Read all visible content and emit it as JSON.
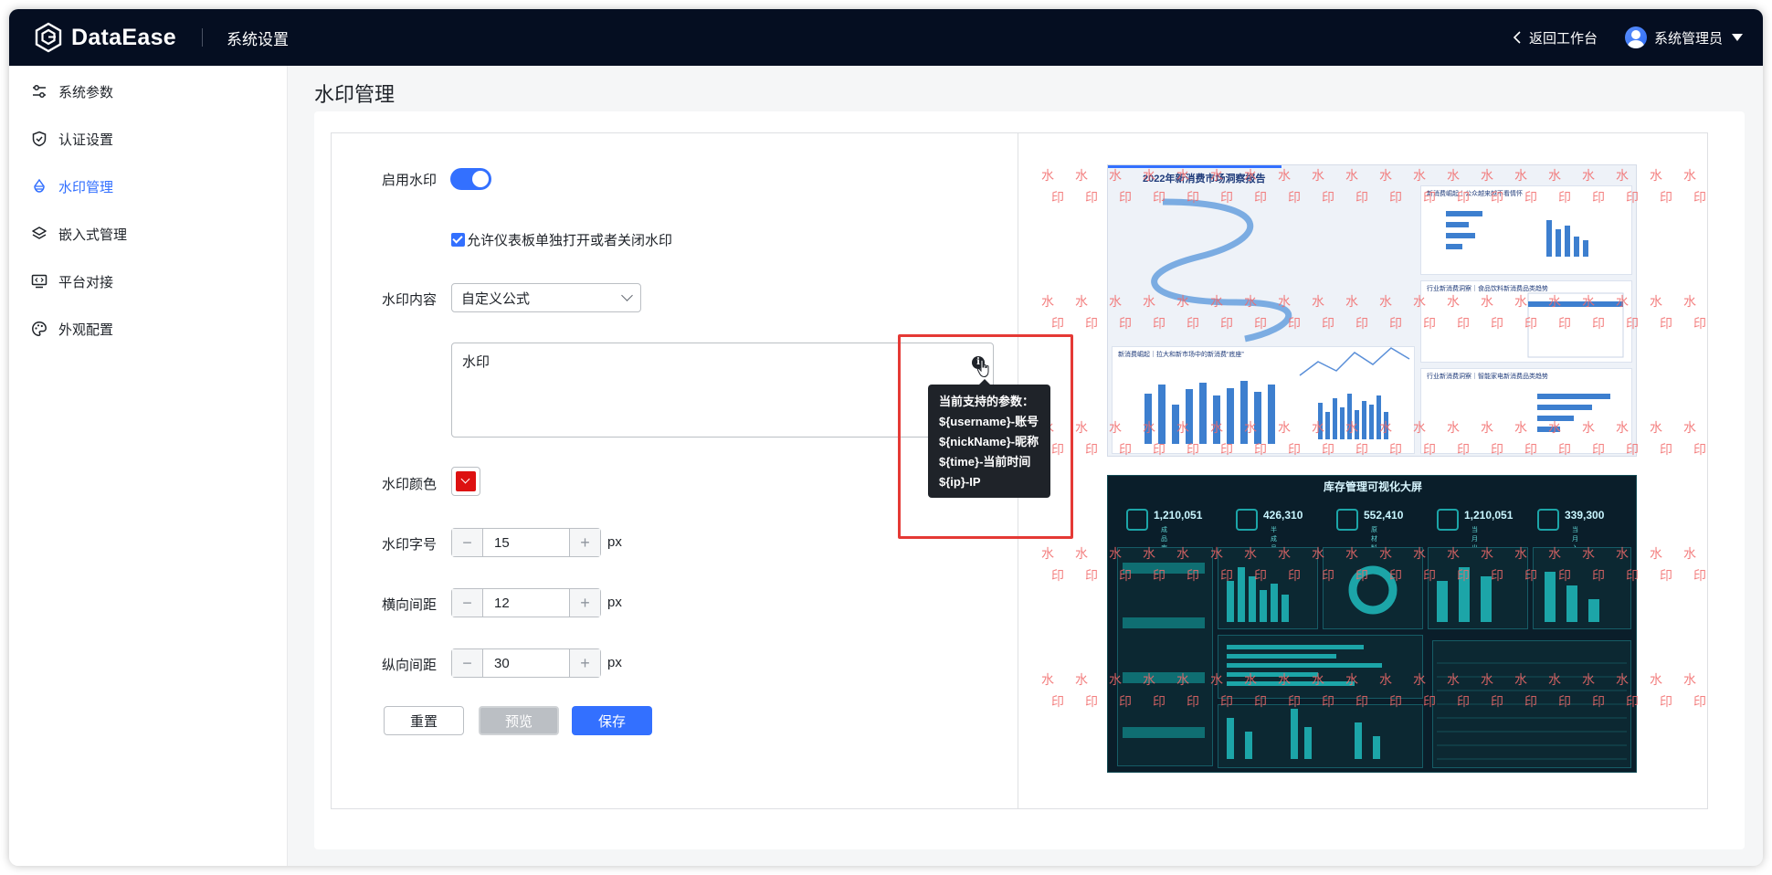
{
  "header": {
    "logo_text": "DataEase",
    "section_title": "系统设置",
    "back_label": "返回工作台",
    "user_name": "系统管理员"
  },
  "sidebar": {
    "items": [
      {
        "label": "系统参数",
        "icon": "sliders-icon",
        "active": false
      },
      {
        "label": "认证设置",
        "icon": "shield-check-icon",
        "active": false
      },
      {
        "label": "水印管理",
        "icon": "watermark-icon",
        "active": true
      },
      {
        "label": "嵌入式管理",
        "icon": "layers-icon",
        "active": false
      },
      {
        "label": "平台对接",
        "icon": "monitor-code-icon",
        "active": false
      },
      {
        "label": "外观配置",
        "icon": "palette-icon",
        "active": false
      }
    ]
  },
  "page": {
    "title": "水印管理"
  },
  "form": {
    "enable_label": "启用水印",
    "enable_on": true,
    "allow_toggle_label": "允许仪表板单独打开或者关闭水印",
    "allow_toggle_checked": true,
    "content_label": "水印内容",
    "content_type": "自定义公式",
    "content_text": "水印",
    "color_label": "水印颜色",
    "color_value": "#DD1111",
    "font_size_label": "水印字号",
    "font_size": "15",
    "h_gap_label": "横向间距",
    "h_gap": "12",
    "v_gap_label": "纵向间距",
    "v_gap": "30",
    "unit": "px",
    "stepper_minus": "−",
    "stepper_plus": "+"
  },
  "actions": {
    "reset": "重置",
    "preview": "预览",
    "save": "保存"
  },
  "tooltip": {
    "lines": [
      "当前支持的参数：",
      "${username}-账号",
      "${nickName}-昵称",
      "${time}-当前时间",
      "${ip}-IP"
    ]
  },
  "preview": {
    "watermark_chars": [
      "水",
      "印"
    ],
    "dashboard1_title": "2022年新消费市场洞察报告",
    "dashboard1_panels": [
      "新消费崛起｜公众越来越不看情怀",
      "行业新消费洞察｜食品饮料新消费品类趋势",
      "新消费崛起｜拉大和新市场中的新消费“底座”",
      "行业新消费洞察｜智能家电新消费品类趋势"
    ],
    "dashboard2_title": "库存管理可视化大屏",
    "dashboard2_kpis": [
      {
        "value": "1,210,051",
        "label": "成品库存"
      },
      {
        "value": "426,310",
        "label": "半成品库存"
      },
      {
        "value": "552,410",
        "label": "原材料库存"
      },
      {
        "value": "1,210,051",
        "label": "当月出库量"
      },
      {
        "value": "339,300",
        "label": "当月入库量"
      }
    ],
    "accent_light": "#3370FF",
    "accent_dark": "#1CA5A8",
    "watermark_color": "#F26A6A"
  },
  "colors": {
    "topbar": "#050E21",
    "primary": "#3370FF",
    "highlight_box": "#E53935"
  }
}
